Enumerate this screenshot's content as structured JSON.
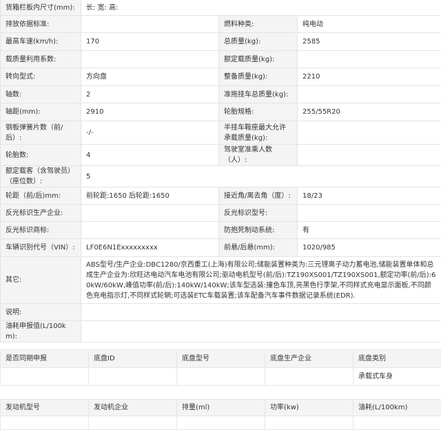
{
  "spec_table": {
    "box_dims_label": "货箱栏板内尺寸(mm):",
    "box_dims_value": "长:  宽:  高:",
    "rows": [
      [
        "排放依据标准:",
        "",
        "燃料种类:",
        "纯电动"
      ],
      [
        "最高车速(km/h):",
        "170",
        "总质量(kg):",
        "2585"
      ],
      [
        "载质量利用系数:",
        "",
        "额定载质量(kg):",
        ""
      ],
      [
        "转向型式:",
        "方向盘",
        "整备质量(kg):",
        "2210"
      ],
      [
        "轴数:",
        "2",
        "准拖挂车总质量(kg):",
        ""
      ],
      [
        "轴距(mm):",
        "2910",
        "轮胎规格:",
        "255/55R20"
      ],
      [
        "钢板弹簧片数（前/后）:",
        "-/-",
        "半挂车鞍座最大允许承载质量(kg):",
        ""
      ],
      [
        "轮胎数:",
        "4",
        "驾驶室准乘人数（人）:",
        ""
      ],
      [
        "额定载客（含驾驶员）（座位数）:",
        "5",
        "",
        ""
      ],
      [
        "轮距（前/后)mm:",
        "前轮距:1650 后轮距:1650",
        "接近角/离去角（度）:",
        "18/23"
      ],
      [
        "反光标识生产企业:",
        "",
        "反光标识型号:",
        ""
      ],
      [
        "反光标识商标:",
        "",
        "防抱死制动系统:",
        "有"
      ],
      [
        "车辆识别代号（VIN）:",
        "LF0E6N1Exxxxxxxxx",
        "前悬/后悬(mm):",
        "1020/985"
      ]
    ],
    "other_label": "其它:",
    "other_value": "ABS型号/生产企业:DBC1280/京西重工(上海)有限公司;储能装置种类为:三元锂离子动力蓄电池,储能装置单体和总成生产企业为:欣旺达电动汽车电池有限公司;驱动电机型号(前/后):TZ190XS001/TZ190XS001,额定功率(前/后):60kW/60kW,峰值功率(前/后):140kW/140kW;该车型选装:撞色车顶,亮黑色行李架,不同样式充电显示面板,不同颜色充电指示灯,不同样式轮辋;可选装ETC车载装置;该车配备汽车事件数据记录系统(EDR).",
    "note_label": "说明:",
    "note_value": "",
    "fuel_label": "油耗申报值(L/100km):",
    "fuel_value": ""
  },
  "chassis_table": {
    "headers": [
      "是否同期申报",
      "底盘ID",
      "底盘型号",
      "底盘生产企业",
      "底盘类别"
    ],
    "row": [
      "",
      "",
      "",
      "",
      "承载式车身"
    ]
  },
  "engine_table": {
    "headers": [
      "发动机型号",
      "发动机企业",
      "排量(ml)",
      "功率(kw)",
      "油耗(L/100km)"
    ]
  }
}
